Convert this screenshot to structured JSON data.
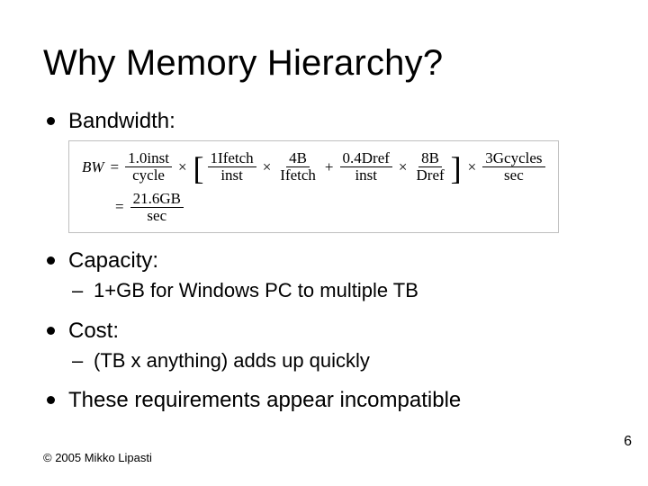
{
  "slide": {
    "title": "Why Memory Hierarchy?",
    "bullets": {
      "b1": {
        "label": "Bandwidth:"
      },
      "b2": {
        "label": "Capacity:",
        "sub": "1+GB for Windows PC to multiple TB"
      },
      "b3": {
        "label": "Cost:",
        "sub": "(TB x anything) adds up quickly"
      },
      "b4": {
        "label": "These requirements appear incompatible"
      }
    },
    "formula": {
      "lhs": "BW",
      "eq": "=",
      "f1": {
        "num": "1.0inst",
        "den": "cycle"
      },
      "t1": "×",
      "lbrk": "[",
      "f2": {
        "num": "1Ifetch",
        "den": "inst"
      },
      "t2": "×",
      "f3": {
        "num": "4B",
        "den": "Ifetch"
      },
      "plus": "+",
      "f4": {
        "num": "0.4Dref",
        "den": "inst"
      },
      "t3": "×",
      "f5": {
        "num": "8B",
        "den": "Dref"
      },
      "rbrk": "]",
      "t4": "×",
      "f6": {
        "num": "3Gcycles",
        "den": "sec"
      },
      "result": {
        "num": "21.6GB",
        "den": "sec"
      }
    },
    "footer": "© 2005 Mikko Lipasti",
    "page": "6"
  }
}
